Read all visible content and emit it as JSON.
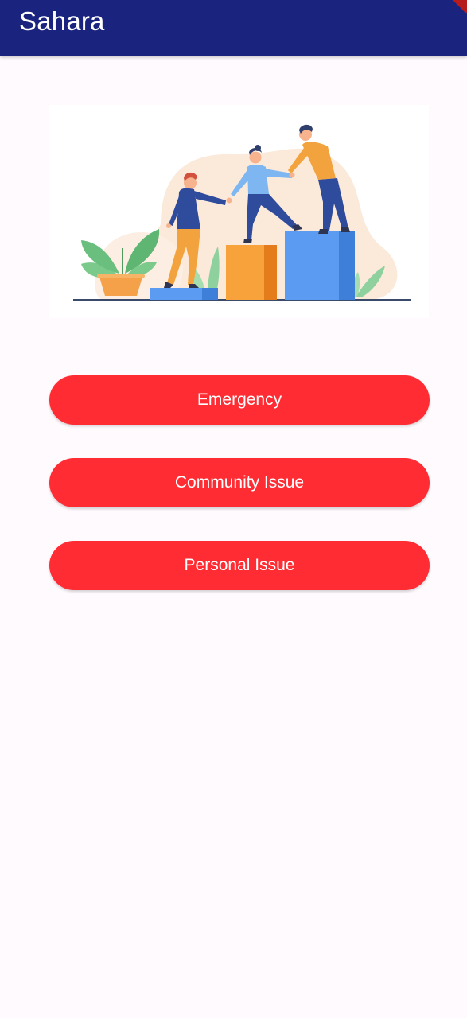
{
  "app_bar": {
    "title": "Sahara",
    "color": "#1A237E"
  },
  "illustration": {
    "icon": "teamwork-climbing-illustration"
  },
  "actions": [
    {
      "label": "Emergency"
    },
    {
      "label": "Community Issue"
    },
    {
      "label": "Personal Issue"
    }
  ],
  "colors": {
    "button": "#FF2D33",
    "background": "#FFFAFD"
  }
}
